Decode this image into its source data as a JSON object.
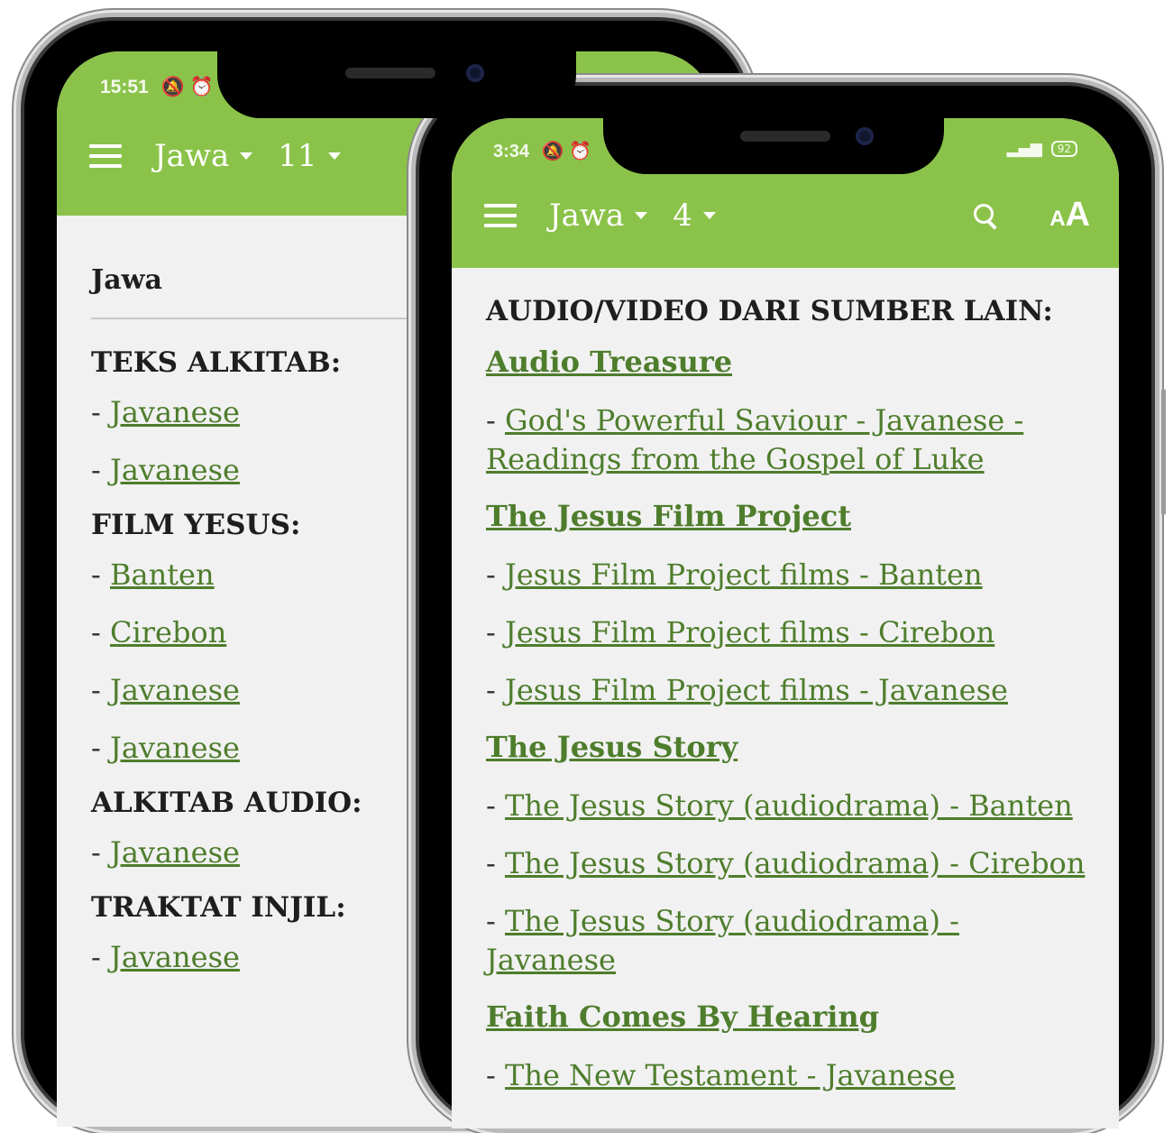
{
  "back_screen": {
    "status_time": "15:51",
    "status_icons": [
      "mute-icon",
      "alarm-icon"
    ],
    "language_label": "Jawa",
    "chapter_label": "11",
    "title": "Jawa",
    "sections": [
      {
        "heading": "TEKS ALKITAB:",
        "links": [
          "Javanese",
          "Javanese"
        ]
      },
      {
        "heading": "FILM YESUS:",
        "links": [
          "Banten",
          "Cirebon",
          "Javanese",
          "Javanese"
        ]
      },
      {
        "heading": "ALKITAB AUDIO:",
        "links": [
          "Javanese"
        ]
      },
      {
        "heading": "TRAKTAT INJIL:",
        "links": [
          "Javanese"
        ]
      }
    ]
  },
  "front_screen": {
    "status_time": "3:34",
    "battery": "92",
    "language_label": "Jawa",
    "chapter_label": "4",
    "font_icon": {
      "small": "A",
      "big": "A"
    },
    "heading": "AUDIO/VIDEO DARI SUMBER LAIN:",
    "groups": [
      {
        "title": "Audio Treasure",
        "links": [
          "God's Powerful Saviour - Javanese - Readings from the Gospel of Luke"
        ]
      },
      {
        "title": "The Jesus Film Project",
        "links": [
          "Jesus Film Project films - Banten",
          "Jesus Film Project films - Cirebon",
          "Jesus Film Project films - Javanese"
        ]
      },
      {
        "title": "The Jesus Story",
        "links": [
          "The Jesus Story (audiodrama) - Banten",
          "The Jesus Story (audiodrama) - Cirebon",
          "The Jesus Story (audiodrama) - Javanese"
        ]
      },
      {
        "title": "Faith Comes By Hearing",
        "links": [
          "The New Testament - Javanese"
        ]
      }
    ],
    "bullet": "- "
  },
  "colors": {
    "app_bar": "#8bc34a",
    "link": "#4e7d2c",
    "background": "#f1f1f1"
  }
}
